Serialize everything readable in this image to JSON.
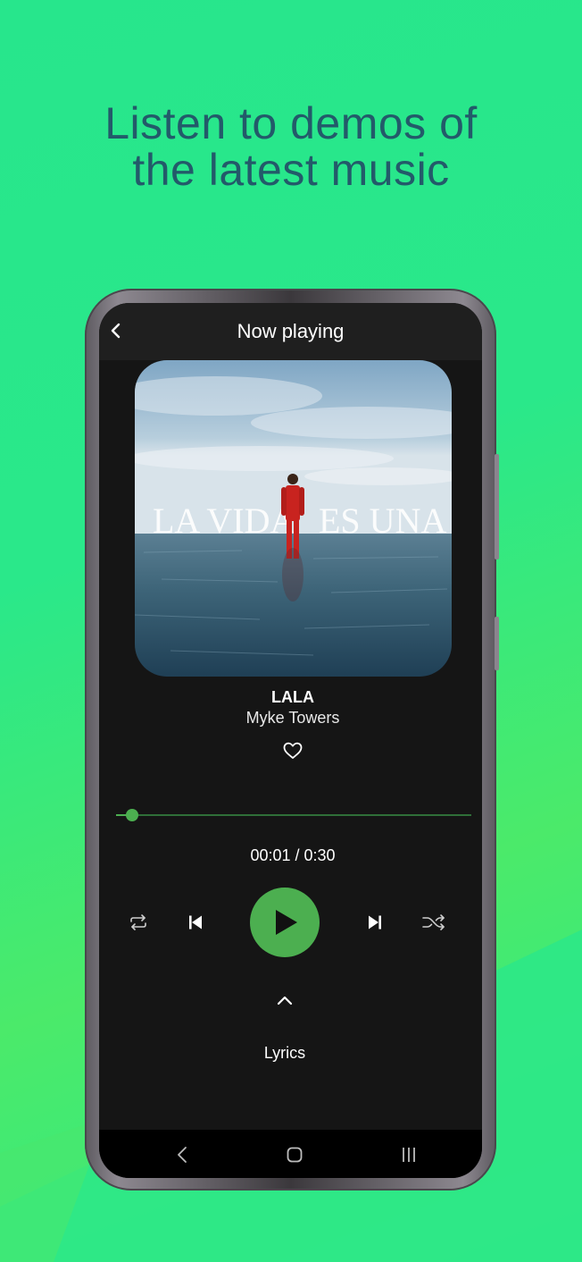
{
  "promo": {
    "headline": "Listen to demos of\nthe latest music"
  },
  "topbar": {
    "back_icon": "chevron-left-icon",
    "title": "Now playing"
  },
  "album": {
    "cover_text_left": "LA VIDA",
    "cover_text_right": "ES UNA"
  },
  "track": {
    "title": "LALA",
    "artist": "Myke Towers",
    "favorite_icon": "heart-outline-icon"
  },
  "progress": {
    "fraction": 0.045,
    "time_text": "00:01 / 0:30"
  },
  "controls": {
    "repeat_icon": "repeat-icon",
    "previous_icon": "skip-previous-icon",
    "play_icon": "play-icon",
    "next_icon": "skip-next-icon",
    "shuffle_icon": "shuffle-icon"
  },
  "lyrics": {
    "expand_icon": "chevron-up-icon",
    "label": "Lyrics"
  },
  "system_nav": {
    "back_icon": "nav-back-icon",
    "home_icon": "nav-home-icon",
    "recents_icon": "nav-recents-icon"
  },
  "colors": {
    "accent": "#4caf50",
    "headline": "#235a6a",
    "screen_bg": "#151515",
    "topbar_bg": "#1f1f1f",
    "background": "#2ae88a"
  }
}
